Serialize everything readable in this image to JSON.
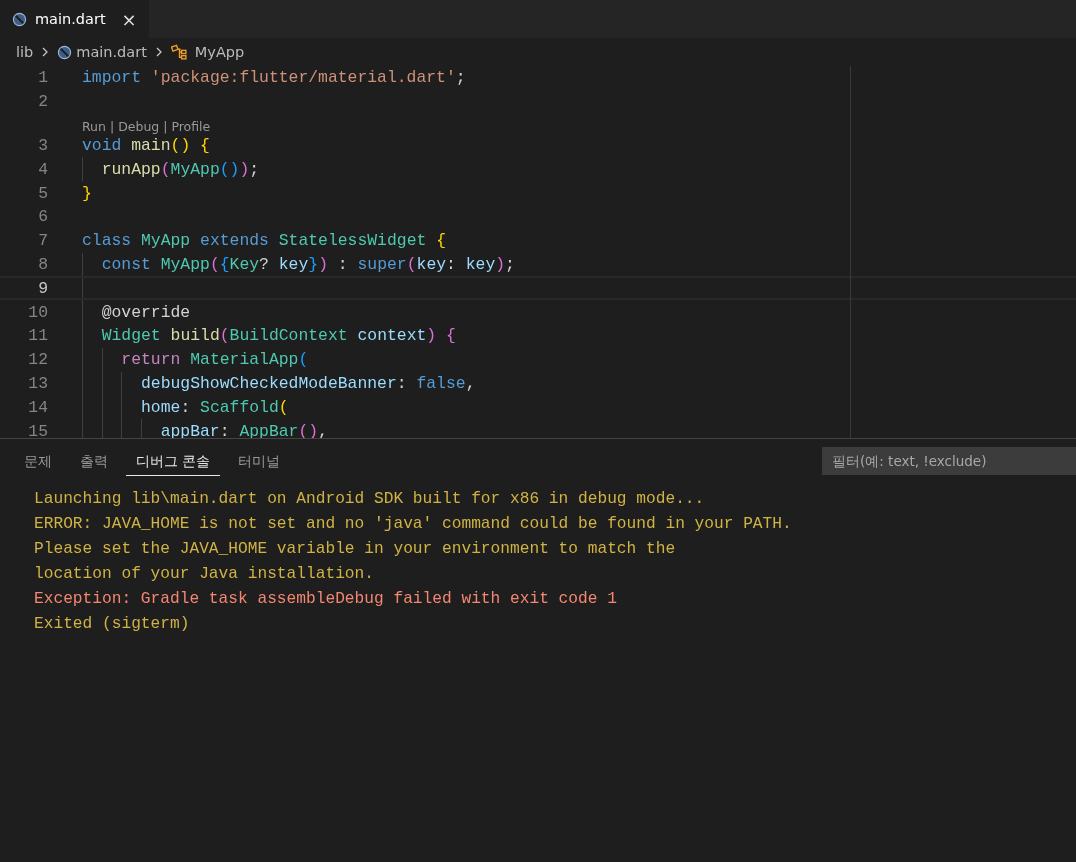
{
  "tabs": [
    {
      "label": "main.dart",
      "selected": true,
      "close": "×"
    }
  ],
  "breadcrumb": [
    {
      "label": "lib"
    },
    {
      "label": "main.dart"
    },
    {
      "label": "MyApp"
    }
  ],
  "editor": {
    "lines": [
      {
        "kind": "code",
        "number": "1",
        "current": false,
        "tokens": [
          {
            "kind": "keyword",
            "text": "import"
          },
          {
            "kind": "string",
            "text": " 'package:flutter/material.dart'"
          },
          {
            "kind": "plain",
            "text": ";"
          }
        ]
      },
      {
        "kind": "code",
        "number": "2",
        "current": false
      },
      {
        "kind": "codelens",
        "text": "Run | Debug | Profile"
      },
      {
        "kind": "code",
        "number": "3",
        "current": false,
        "tokens": [
          {
            "kind": "keyword",
            "text": "void"
          },
          {
            "kind": "function",
            "text": " main"
          },
          {
            "kind": "bracket1",
            "text": "()"
          },
          {
            "kind": "bracket1",
            "text": " {"
          }
        ]
      },
      {
        "kind": "code",
        "number": "4",
        "current": false,
        "tokens": [
          {
            "kind": "function",
            "text": "  runApp"
          },
          {
            "kind": "bracket2",
            "text": "("
          },
          {
            "kind": "type",
            "text": "MyApp"
          },
          {
            "kind": "bracket3",
            "text": "()"
          },
          {
            "kind": "bracket2",
            "text": ")"
          },
          {
            "kind": "plain",
            "text": ";"
          }
        ]
      },
      {
        "kind": "code",
        "number": "5",
        "current": false,
        "tokens": [
          {
            "kind": "bracket1",
            "text": "}"
          }
        ]
      },
      {
        "kind": "code",
        "number": "6",
        "current": false
      },
      {
        "kind": "code",
        "number": "7",
        "current": false,
        "tokens": [
          {
            "kind": "keyword",
            "text": "class"
          },
          {
            "kind": "type",
            "text": " MyApp"
          },
          {
            "kind": "keyword",
            "text": " extends"
          },
          {
            "kind": "type",
            "text": " StatelessWidget"
          },
          {
            "kind": "bracket1",
            "text": " {"
          }
        ]
      },
      {
        "kind": "code",
        "number": "8",
        "current": false,
        "tokens": [
          {
            "kind": "keyword",
            "text": "  const"
          },
          {
            "kind": "type",
            "text": " MyApp"
          },
          {
            "kind": "bracket2",
            "text": "("
          },
          {
            "kind": "bracket3",
            "text": "{"
          },
          {
            "kind": "type",
            "text": "Key"
          },
          {
            "kind": "plain",
            "text": "?"
          },
          {
            "kind": "variable",
            "text": " key"
          },
          {
            "kind": "bracket3",
            "text": "}"
          },
          {
            "kind": "bracket2",
            "text": ")"
          },
          {
            "kind": "plain",
            "text": " :"
          },
          {
            "kind": "keyword",
            "text": " super"
          },
          {
            "kind": "bracket2",
            "text": "("
          },
          {
            "kind": "variable",
            "text": "key"
          },
          {
            "kind": "plain",
            "text": ":"
          },
          {
            "kind": "variable",
            "text": " key"
          },
          {
            "kind": "bracket2",
            "text": ")"
          },
          {
            "kind": "plain",
            "text": ";"
          }
        ]
      },
      {
        "kind": "code",
        "number": "9",
        "current": true
      },
      {
        "kind": "code",
        "number": "10",
        "current": false,
        "tokens": [
          {
            "kind": "plain",
            "text": "  @override"
          }
        ]
      },
      {
        "kind": "code",
        "number": "11",
        "current": false,
        "tokens": [
          {
            "kind": "type",
            "text": "  Widget"
          },
          {
            "kind": "function",
            "text": " build"
          },
          {
            "kind": "bracket2",
            "text": "("
          },
          {
            "kind": "type",
            "text": "BuildContext"
          },
          {
            "kind": "variable",
            "text": " context"
          },
          {
            "kind": "bracket2",
            "text": ")"
          },
          {
            "kind": "bracket2",
            "text": " {"
          }
        ]
      },
      {
        "kind": "code",
        "number": "12",
        "current": false,
        "tokens": [
          {
            "kind": "control",
            "text": "    return"
          },
          {
            "kind": "type",
            "text": " MaterialApp"
          },
          {
            "kind": "bracket3",
            "text": "("
          }
        ]
      },
      {
        "kind": "code",
        "number": "13",
        "current": false,
        "tokens": [
          {
            "kind": "variable",
            "text": "      debugShowCheckedModeBanner"
          },
          {
            "kind": "plain",
            "text": ":"
          },
          {
            "kind": "keyword",
            "text": " false"
          },
          {
            "kind": "plain",
            "text": ","
          }
        ]
      },
      {
        "kind": "code",
        "number": "14",
        "current": false,
        "tokens": [
          {
            "kind": "variable",
            "text": "      home"
          },
          {
            "kind": "plain",
            "text": ":"
          },
          {
            "kind": "type",
            "text": " Scaffold"
          },
          {
            "kind": "bracket1",
            "text": "("
          }
        ]
      },
      {
        "kind": "code",
        "number": "15",
        "current": false,
        "tokens": [
          {
            "kind": "variable",
            "text": "        appBar"
          },
          {
            "kind": "plain",
            "text": ":"
          },
          {
            "kind": "type",
            "text": " AppBar"
          },
          {
            "kind": "bracket2",
            "text": "()"
          },
          {
            "kind": "plain",
            "text": ","
          }
        ]
      }
    ]
  },
  "panel": {
    "tabs": [
      {
        "label": "문제",
        "selected": false
      },
      {
        "label": "출력",
        "selected": false
      },
      {
        "label": "디버그 콘솔",
        "selected": true
      },
      {
        "label": "터미널",
        "selected": false
      }
    ],
    "filter": {
      "placeholder": "필터(예: text, !exclude)"
    },
    "output": [
      {
        "kind": "info",
        "text": "Launching lib\\main.dart on Android SDK built for x86 in debug mode..."
      },
      {
        "kind": "info",
        "text": "ERROR: JAVA_HOME is not set and no 'java' command could be found in your PATH."
      },
      {
        "kind": "info",
        "text": "Please set the JAVA_HOME variable in your environment to match the"
      },
      {
        "kind": "info",
        "text": "location of your Java installation."
      },
      {
        "kind": "error",
        "text": "Exception: Gradle task assembleDebug failed with exit code 1"
      },
      {
        "kind": "info",
        "text": "Exited (sigterm)"
      }
    ]
  }
}
